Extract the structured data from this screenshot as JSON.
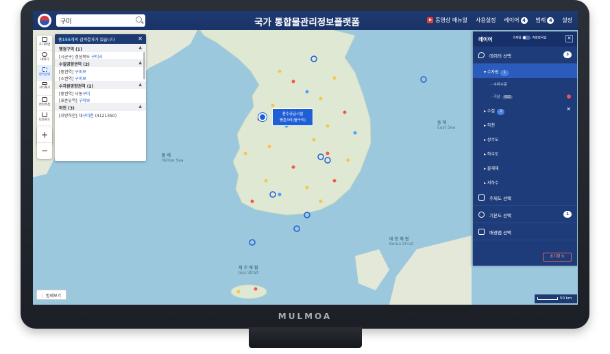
{
  "brand": "MULMOA",
  "header": {
    "search_value": "구미",
    "title": "국가 통합물관리정보플랫폼",
    "video_manual": "동영상 매뉴얼",
    "user_settings": "사용설정",
    "layers_label": "레이어",
    "layers_count": "4",
    "legend_label": "범례",
    "legend_count": "4",
    "settings": "설정"
  },
  "toolbar": {
    "items": [
      "초기화면",
      "내위치",
      "영역선택",
      "거리재기",
      "면적측정",
      "다운로드"
    ],
    "zoom_in": "+",
    "zoom_out": "−"
  },
  "results": {
    "prefix": "총",
    "count": "155개",
    "suffix": "의 검색결과가 있습니다",
    "sections": [
      {
        "title": "행정구역 (1)",
        "rows": [
          {
            "tag": "[시군구]",
            "text": "경상북도 ",
            "hl": "구미시"
          }
        ]
      },
      {
        "title": "수질영향권역 (2)",
        "rows": [
          {
            "tag": "[중권역]",
            "text": "",
            "hl": "구미보"
          },
          {
            "tag": "[소권역]",
            "text": "",
            "hl": "구미보"
          }
        ]
      },
      {
        "title": "수자원영향권역 (2)",
        "rows": [
          {
            "tag": "[중권역]",
            "text": "낙동",
            "hl": "구미"
          },
          {
            "tag": "[표준유역]",
            "text": "",
            "hl": "구미보"
          }
        ]
      },
      {
        "title": "하천 (3)",
        "rows": [
          {
            "tag": "[지방하천]",
            "text": "대",
            "hl": "구미천",
            "extra": " (4121350)"
          }
        ]
      }
    ]
  },
  "callout": {
    "line1": "용수공급시설",
    "line2": "평촌3리(월구리)"
  },
  "map_labels": {
    "yellow_sea": "황  해",
    "yellow_sea_en": "Yellow Sea",
    "east_sea": "동  해",
    "east_sea_en": "East Sea",
    "korea_strait": "대 한 해 협",
    "korea_strait_en": "Korea Strait",
    "jeju_strait": "제 주 해 협",
    "jeju_strait_en": "Jeju Strait"
  },
  "legend_button": "범례보기",
  "scale": "50 km",
  "layer_panel": {
    "title": "레이어",
    "toggle_left": "주제별",
    "toggle_right": "측정항목별",
    "data_select": "데이터 선택",
    "data_count": "3",
    "water_resources": "수자원",
    "water_resources_count": "1",
    "water_level": "수위수문",
    "weather": "기상",
    "weather_count": "682",
    "water_quality": "수질",
    "water_quality_count": "2",
    "items": [
      "하천",
      "상수도",
      "하수도",
      "물재해",
      "지하수"
    ],
    "theme_select": "주제도 선택",
    "base_select": "기본도 선택",
    "base_count": "1",
    "bg_select": "배경맵 선택",
    "reset": "초기화"
  },
  "colors": {
    "header": "#1e3a72",
    "accent": "#1f5fd6",
    "sea": "#9cc8de",
    "land": "#dfe8d3"
  }
}
